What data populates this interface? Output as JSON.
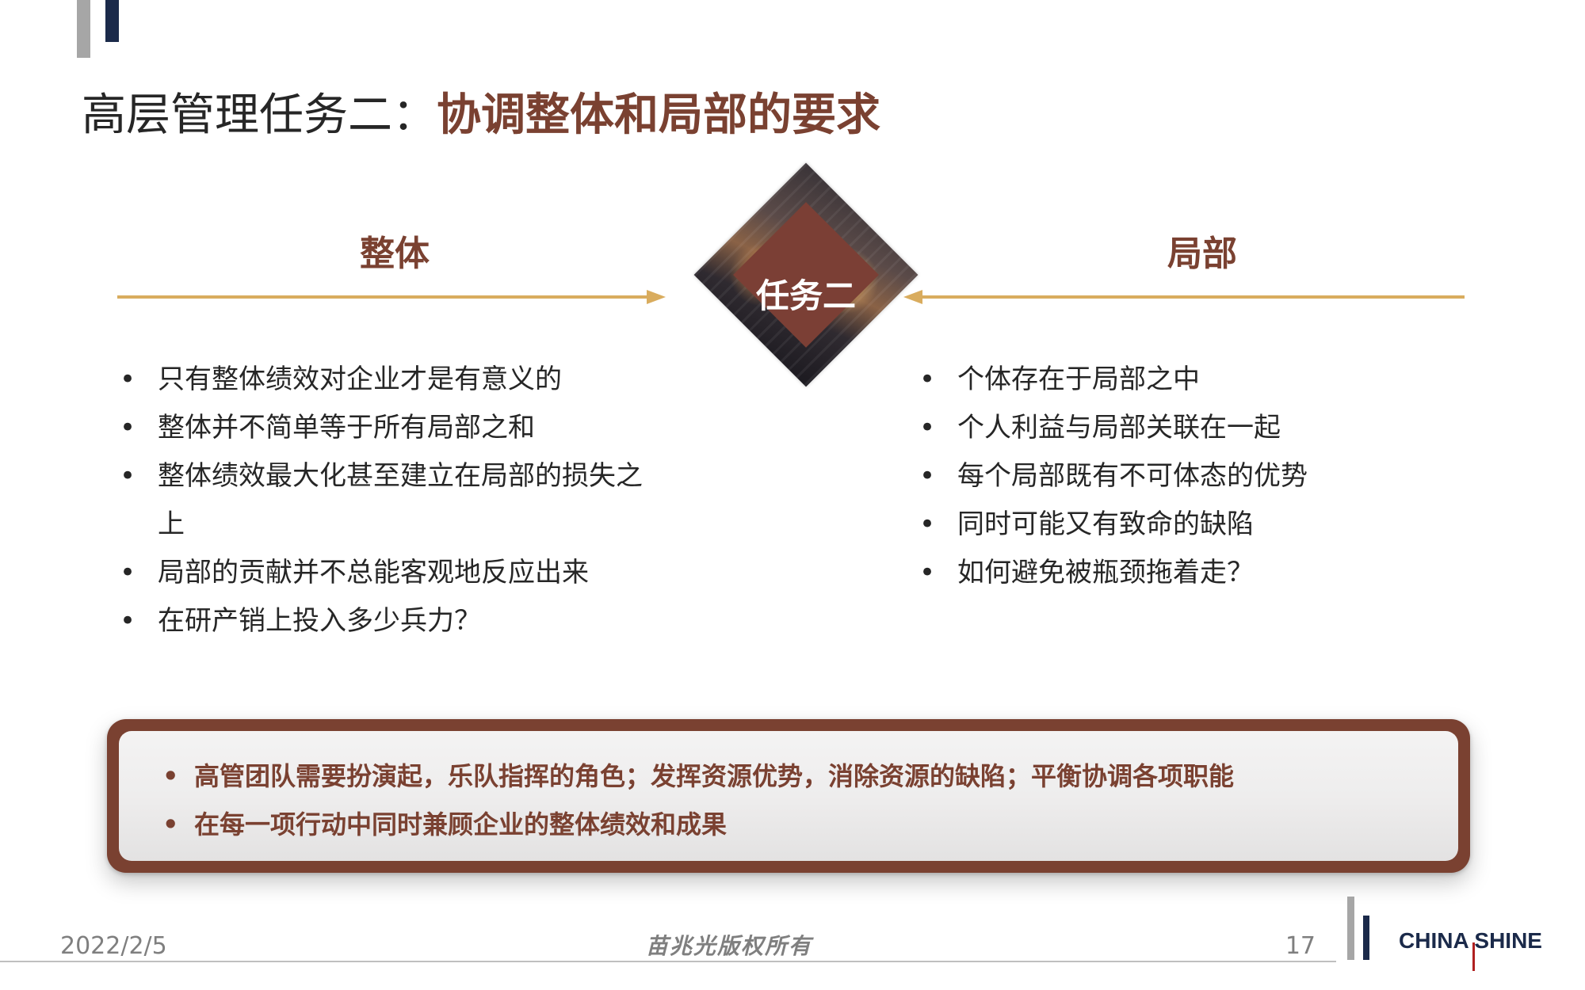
{
  "title": {
    "plain": "高层管理任务二：",
    "accent": "协调整体和局部的要求"
  },
  "left": {
    "heading": "整体",
    "items": [
      "只有整体绩效对企业才是有意义的",
      "整体并不简单等于所有局部之和",
      "整体绩效最大化甚至建立在局部的损失之上",
      "局部的贡献并不总能客观地反应出来",
      "在研产销上投入多少兵力？"
    ]
  },
  "center": {
    "label": "任务二"
  },
  "right": {
    "heading": "局部",
    "items": [
      "个体存在于局部之中",
      "个人利益与局部关联在一起",
      "每个局部既有不可体态的优势",
      "同时可能又有致命的缺陷",
      "如何避免被瓶颈拖着走？"
    ]
  },
  "summary": {
    "items": [
      "高管团队需要扮演起，乐队指挥的角色；发挥资源优势，消除资源的缺陷；平衡协调各项职能",
      "在每一项行动中同时兼顾企业的整体绩效和成果"
    ]
  },
  "bullet": "•",
  "footer": {
    "date": "2022/2/5",
    "copyright": "苗兆光版权所有",
    "page": "17"
  },
  "logo": {
    "text": "CHINA SHINE"
  },
  "colors": {
    "accent": "#7a4131",
    "arrow": "#d9ac5e",
    "navy": "#1b2a4a",
    "gray": "#a6a6a6"
  }
}
